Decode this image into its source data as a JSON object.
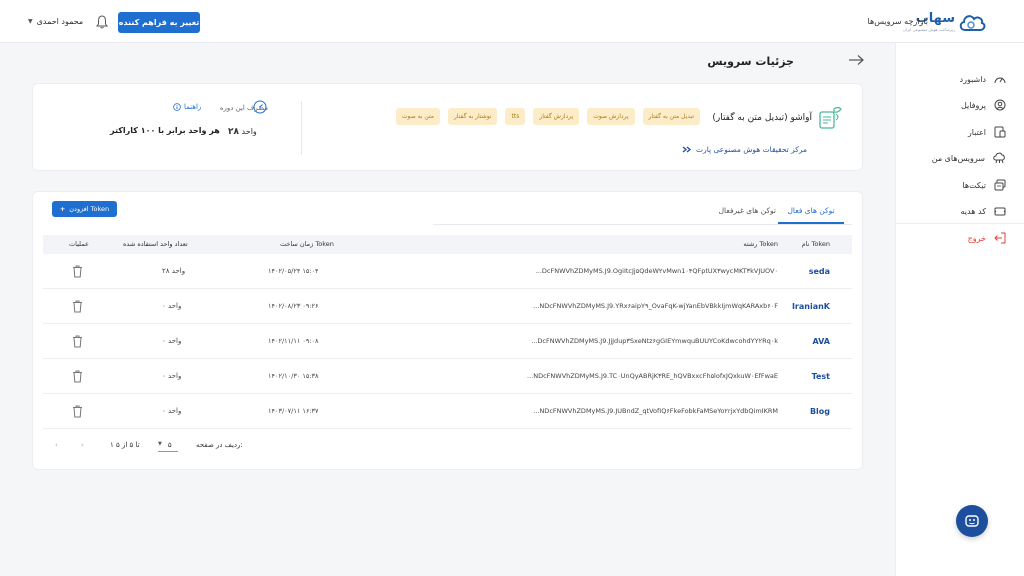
{
  "topbar": {
    "logo_text": "سهاب",
    "logo_tagline": "زیرساخت هوش مصنوعی ایران",
    "market_link": "بازارچه سرویس‌ها",
    "provider_button": "تغییر به فراهم کننده",
    "user_name": "محمود احمدی"
  },
  "sidebar": {
    "items": [
      {
        "label": "داشبورد",
        "icon": "dashboard-icon"
      },
      {
        "label": "پروفایل",
        "icon": "user-icon"
      },
      {
        "label": "اعتبار",
        "icon": "wallet-icon"
      },
      {
        "label": "سرویس‌های من",
        "icon": "cloud-icon"
      },
      {
        "label": "تیکت‌ها",
        "icon": "ticket-icon"
      },
      {
        "label": "کد هدیه",
        "icon": "gift-icon"
      }
    ],
    "logout": "خروج"
  },
  "page": {
    "title": "جزئیات سرویس"
  },
  "service": {
    "name": "آواشو (تبدیل متن به گفتار)",
    "tags": [
      "تبدیل متن به گفتار",
      "پردازش صوت",
      "پردازش گفتار",
      "tts",
      "نوشتار به گفتار",
      "متن به صوت"
    ],
    "provider": "مرکز تحقیقات هوش مصنوعی پارت",
    "usage_label": "مصرف این دوره",
    "usage_value": "۲۸",
    "usage_unit": "واحد",
    "guide_label": "راهنما",
    "rate_text": "هر واحد برابر با ۱۰۰ کاراکتر"
  },
  "tokens": {
    "tab_active": "توکن های فعال",
    "tab_inactive": "توکن های غیرفعال",
    "add_button": "افزودن Token",
    "columns": {
      "name": "نام Token",
      "token": "رشته Token",
      "created": "زمان ساخت Token",
      "used": "تعداد واحد استفاده شده",
      "actions": "عملیات"
    },
    "rows": [
      {
        "name": "seda",
        "token": "...DcFNWVhZDMyMS.J9.OgiItcJj۵QdeW۲vMwn1۰۴QFptUX۳wycMKT۳kVJUOV۰",
        "created": "۱۴۰۲/۰۵/۲۴ ۱۵:۰۴",
        "used": "۲۸ واحد"
      },
      {
        "name": "IranianK",
        "token": "...NDcFNWVhZDMyMS.J9.YRx۶aipY۹_OvaFqK-wjYanEbVBkkIjmWqKARAxb۶۰F",
        "created": "۱۴۰۲/۰۸/۲۳ ۰۹:۲۶",
        "used": "۰ واحد"
      },
      {
        "name": "AVA",
        "token": "...DcFNWVhZDMyMS.J9.JjJdup۳SxeNtz۶gGIEYmwquBUUYCoKdwcohdYY۲Rq۰k",
        "created": "۱۴۰۲/۱۱/۱۱ ۰۹:۰۸",
        "used": "۰ واحد"
      },
      {
        "name": "Test",
        "token": "...NDcFNWVhZDMyMS.J9.TC۰UnQyABRjK۳RE_hQVBxxcFh۵lofxJQxkuW۰EfFwaE",
        "created": "۱۴۰۲/۱۰/۳۰ ۱۵:۳۸",
        "used": "۰ واحد"
      },
      {
        "name": "Blog",
        "token": "...NDcFNWVhZDMyMS.J9.JUBndZ_qtVofIQ۶FkeFobkFaMSeYo۲rjxYdbQimIKRM",
        "created": "۱۴۰۳/۰۷/۱۱ ۱۶:۳۷",
        "used": "۰ واحد"
      }
    ],
    "pagination": {
      "rows_per_page_label": "ردیف در صفحه:",
      "rows_per_page": "۵",
      "range": "۱ تا ۵ از ۵"
    }
  },
  "colors": {
    "primary": "#1f6fd0",
    "brand": "#1d4f9e",
    "tag_bg": "#fdecc8",
    "tag_text": "#b07a1a",
    "logout": "#e0403c"
  }
}
